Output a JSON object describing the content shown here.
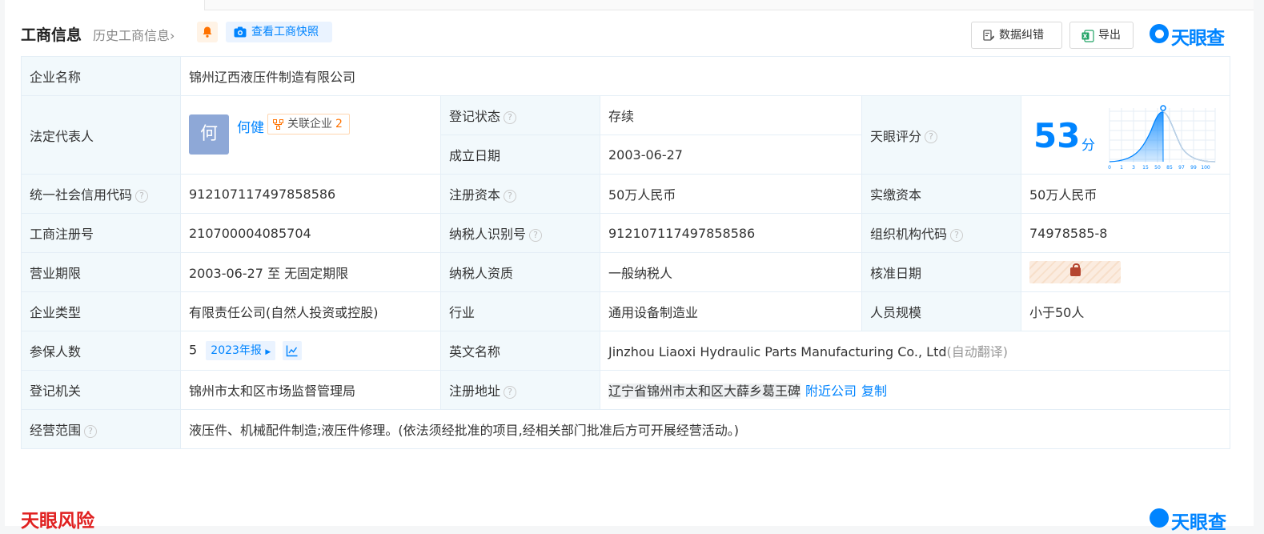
{
  "header": {
    "title": "工商信息",
    "history_link": "历史工商信息",
    "history_chevron": "›",
    "snapshot_button": "查看工商快照",
    "correct_button": "数据纠错",
    "export_button": "导出",
    "brand": "天眼查"
  },
  "company": {
    "name_label": "企业名称",
    "name_value": "锦州辽西液压件制造有限公司",
    "legal_rep_label": "法定代表人",
    "legal_rep_avatar": "何",
    "legal_rep_name": "何健",
    "related_label": "关联企业",
    "related_count": "2",
    "status_label": "登记状态",
    "status_value": "存续",
    "established_label": "成立日期",
    "established_value": "2003-06-27",
    "score_label": "天眼评分",
    "score_value": "53",
    "score_unit": "分",
    "score_axis": [
      "0",
      "1",
      "3",
      "15",
      "50",
      "85",
      "97",
      "99",
      "100"
    ],
    "credit_code_label": "统一社会信用代码",
    "credit_code_value": "912107117497858586",
    "reg_capital_label": "注册资本",
    "reg_capital_value": "50万人民币",
    "paid_capital_label": "实缴资本",
    "paid_capital_value": "50万人民币",
    "reg_no_label": "工商注册号",
    "reg_no_value": "210700004085704",
    "taxpayer_id_label": "纳税人识别号",
    "taxpayer_id_value": "912107117497858586",
    "org_code_label": "组织机构代码",
    "org_code_value": "74978585-8",
    "term_label": "营业期限",
    "term_value": "2003-06-27 至 无固定期限",
    "taxpayer_qual_label": "纳税人资质",
    "taxpayer_qual_value": "一般纳税人",
    "approval_date_label": "核准日期",
    "type_label": "企业类型",
    "type_value": "有限责任公司(自然人投资或控股)",
    "industry_label": "行业",
    "industry_value": "通用设备制造业",
    "staff_label": "人员规模",
    "staff_value": "小于50人",
    "insured_label": "参保人数",
    "insured_value": "5",
    "insured_report": "2023年报",
    "english_label": "英文名称",
    "english_value": "Jinzhou Liaoxi Hydraulic Parts Manufacturing Co., Ltd",
    "english_note": "(自动翻译)",
    "authority_label": "登记机关",
    "authority_value": "锦州市太和区市场监督管理局",
    "address_label": "注册地址",
    "address_value": "辽宁省锦州市太和区大薛乡葛王碑",
    "nearby_link": "附近公司",
    "copy_link": "复制",
    "scope_label": "经营范围",
    "scope_value": "液压件、机械配件制造;液压件修理。(依法须经批准的项目,经相关部门批准后方可开展经营活动。)"
  },
  "next_section": {
    "title": "天眼风险",
    "brand": "天眼查"
  },
  "colors": {
    "accent": "#0084ff",
    "status_green": "#26a449",
    "label_bg": "#f2f9fc",
    "risk_red": "#e02020"
  }
}
